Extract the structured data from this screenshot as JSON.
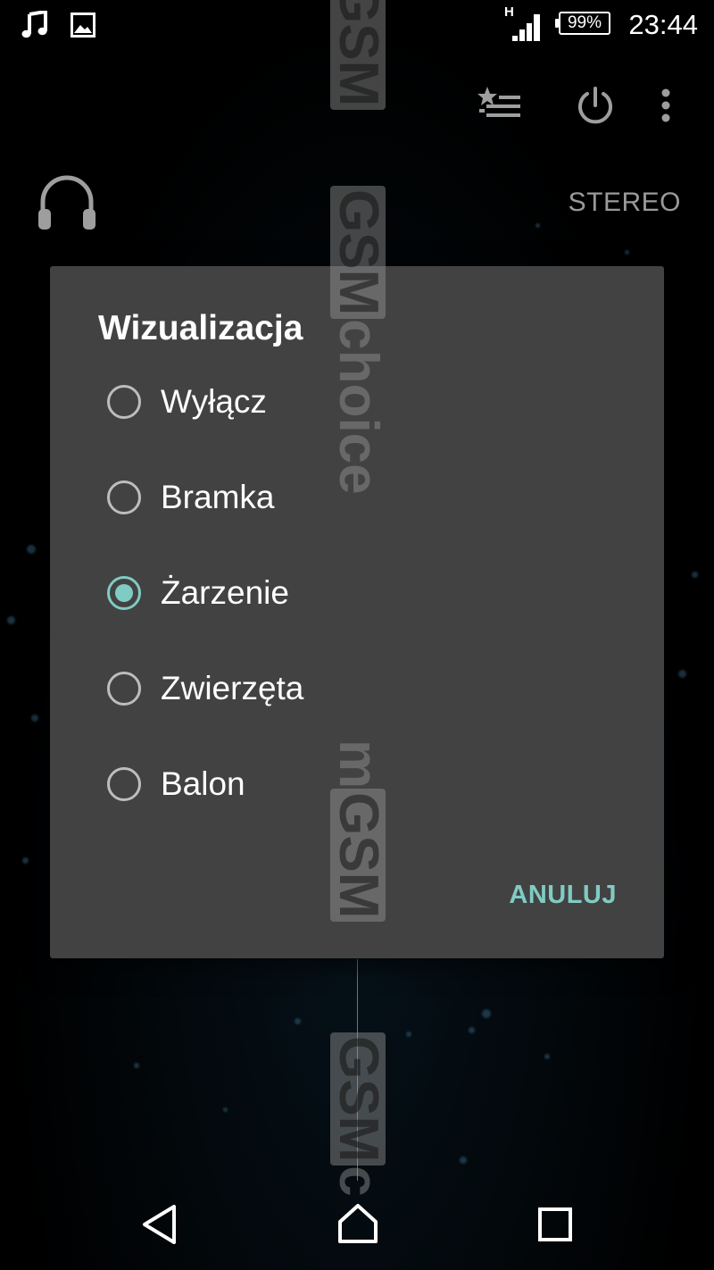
{
  "status_bar": {
    "time": "23:44",
    "battery": "99%",
    "network_type": "H",
    "icons": [
      "music-note-icon",
      "image-icon",
      "signal-icon",
      "battery-icon"
    ]
  },
  "action_bar": {
    "icons": [
      "favorites-list-icon",
      "power-icon",
      "overflow-menu-icon"
    ]
  },
  "player": {
    "audio_mode": "STEREO",
    "output_icon": "headphones-icon"
  },
  "dialog": {
    "title": "Wizualizacja",
    "options": [
      {
        "label": "Wyłącz",
        "selected": false
      },
      {
        "label": "Bramka",
        "selected": false
      },
      {
        "label": "Żarzenie",
        "selected": true
      },
      {
        "label": "Zwierzęta",
        "selected": false
      },
      {
        "label": "Balon",
        "selected": false
      }
    ],
    "cancel_label": "ANULUJ",
    "accent_color": "#80cbc4"
  },
  "watermark": {
    "text_1": "GSM",
    "text_2": "choice",
    "text_3": "m",
    "text_4": "GSM",
    "text_5": "GSM",
    "text_6": "c"
  },
  "nav_bar": {
    "icons": [
      "back-icon",
      "home-icon",
      "recents-icon"
    ]
  }
}
